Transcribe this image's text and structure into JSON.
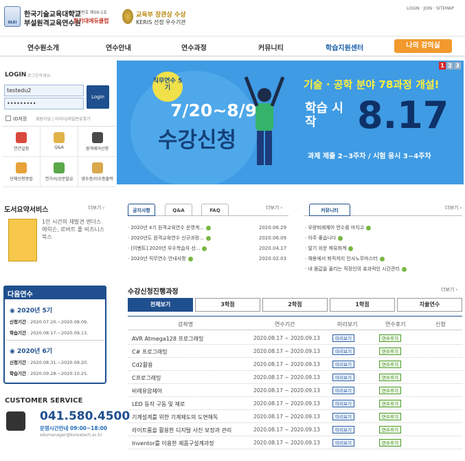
{
  "header": {
    "logo_mark": "DLEI",
    "org_name_1": "한국기술교육대학교",
    "org_name_2": "부설원격교육연수원",
    "sub_1": "인가번호 제09-1호",
    "sub_2": "한기대에듀클럽",
    "award_1": "교육부 장관상 수상",
    "award_2": "KERIS 선정 우수기관",
    "top_links": "LOGIN · JOIN · SITEMAP"
  },
  "nav": {
    "items": [
      "연수원소개",
      "연수안내",
      "연수과정",
      "커뮤니티",
      "학습지원센터"
    ],
    "my_course": "나의 강의실"
  },
  "login": {
    "title": "LOGIN",
    "subtitle": "로그인하세요.",
    "id_value": "testedu2",
    "pw_value": "•••••••••",
    "button": "Login",
    "save_id": "ID저장",
    "links": "회원가입 | 아이디/비밀번호찾기"
  },
  "quick_menu": [
    "연간일정",
    "Q&A",
    "원격제어신청",
    "단체신청방법",
    "연가서/공문발급",
    "영수증/이수증출력"
  ],
  "banner": {
    "tag": "직무연수 5기",
    "date": "7/20~8/9",
    "main": "수강신청",
    "headline": "기술 · 공학 분야 78과정 개설!",
    "study_start": "학습 시작",
    "start_date": "8.17",
    "sub": "과제 제출 2~3주차 / 시험 응시 3~4주차",
    "pages": [
      "1",
      "2",
      "3"
    ]
  },
  "book": {
    "title": "도서요약서비스",
    "more": "더보기 ›",
    "desc": "1만 시간의 재발견 앤더스 에릭슨, 로버트 풀 비즈니스북스"
  },
  "next_course": {
    "title": "다음연수",
    "items": [
      {
        "name": "2020년 5기",
        "apply_label": "신청기간",
        "apply": "2020.07.20.~2020.08.09.",
        "study_label": "학습기간",
        "study": "2020.08.17.~2020.09.13."
      },
      {
        "name": "2020년 6기",
        "apply_label": "신청기간",
        "apply": "2020.08.31.~2020.09.20.",
        "study_label": "학습기간",
        "study": "2020.09.28.~2020.10.25."
      }
    ]
  },
  "customer_service": {
    "title": "CUSTOMER SERVICE",
    "phone": "041.580.4500",
    "hours": "운영시간안내 09:00~18:00",
    "email": "edumanager@koreatech.ac.kr"
  },
  "notice": {
    "tabs": [
      "공지사항",
      "Q&A",
      "FAQ"
    ],
    "more": "더보기 ›",
    "rows": [
      {
        "title": "2020년 4기 원격교육연수 운영계...",
        "date": "2020.06.29"
      },
      {
        "title": "2020년도 원격교육연수 신규과정...",
        "date": "2020.06.09"
      },
      {
        "title": "[이벤트] 2020년 우수학습자 선...",
        "date": "2020.04.17"
      },
      {
        "title": "2020년 직무연수 안내사항",
        "date": "2020.02.03"
      }
    ]
  },
  "community": {
    "tab": "커뮤니티",
    "more": "더보기 ›",
    "rows": [
      "우량비례체어 연수를 마치고",
      "아주 좋습니다",
      "알기 쉬운 제유화계",
      "채용에서 퇴직까지 인사노무마스터",
      "내 몸값을 올리는 직장인의 효과적인 시간관리"
    ]
  },
  "progress": {
    "title": "수강신청진행과정",
    "more": "더보기 ›",
    "tabs": [
      "전체보기",
      "3학점",
      "2학점",
      "1학점",
      "자율연수"
    ],
    "headers": [
      "강좌명",
      "연수기간",
      "미리보기",
      "연수후기",
      "신청"
    ],
    "preview_label": "미리보기",
    "review_label": "연수후기",
    "rows": [
      {
        "name": "AVR Atmega128 프로그래밍",
        "period": "2020.08.17 ~ 2020.09.13"
      },
      {
        "name": "C# 프로그래밍",
        "period": "2020.08.17 ~ 2020.09.13"
      },
      {
        "name": "Cd2활용",
        "period": "2020.08.17 ~ 2020.09.13"
      },
      {
        "name": "C프로그래밍",
        "period": "2020.08.17 ~ 2020.09.13"
      },
      {
        "name": "비례유압제어",
        "period": "2020.08.17 ~ 2020.09.13"
      },
      {
        "name": "LED 동작 구동 및 제로",
        "period": "2020.08.17 ~ 2020.09.13"
      },
      {
        "name": "기계설계를 위한 기계제도의 도면해독",
        "period": "2020.08.17 ~ 2020.09.13"
      },
      {
        "name": "라이트룸을 활용한 디지털 사진 보정과 관리",
        "period": "2020.08.17 ~ 2020.09.13"
      },
      {
        "name": "Inventor를 이용한 제품구설계과정",
        "period": "2020.08.17 ~ 2020.09.13"
      }
    ]
  }
}
